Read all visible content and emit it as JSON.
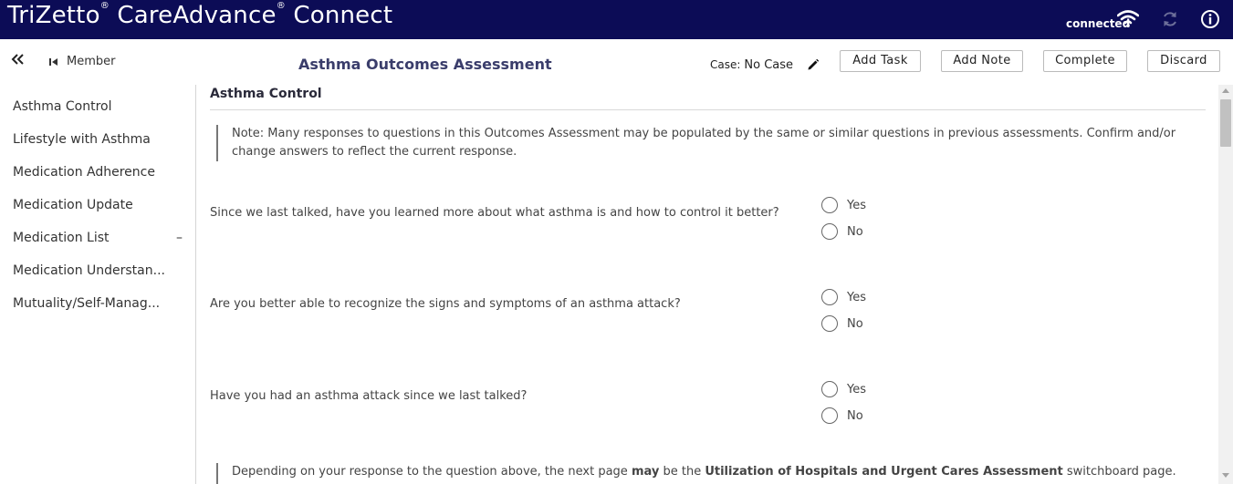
{
  "app": {
    "title": "TriZetto® CareAdvance® Connect",
    "title_parts": [
      "TriZetto",
      "®",
      " CareAdvance",
      "®",
      " Connect"
    ],
    "connection_status": "connected",
    "icons": {
      "connection": "wifi-icon",
      "sync": "sync-icon",
      "info": "info-icon"
    }
  },
  "header": {
    "collapse_icon": "double-chevron-left-icon",
    "member_label": "Member",
    "page_title": "Asthma Outcomes Assessment",
    "case_label": "Case:",
    "case_value": "No Case",
    "buttons": {
      "add_task": "Add Task",
      "add_note": "Add Note",
      "complete": "Complete",
      "discard": "Discard"
    }
  },
  "sidebar": {
    "items": [
      {
        "label": "Asthma Control"
      },
      {
        "label": "Lifestyle with Asthma"
      },
      {
        "label": "Medication Adherence"
      },
      {
        "label": "Medication Update"
      },
      {
        "label": "Medication List",
        "suffix": "–"
      },
      {
        "label": "Medication Understan..."
      },
      {
        "label": "Mutuality/Self-Manag..."
      }
    ]
  },
  "main": {
    "section_title": "Asthma Control",
    "note": "Note: Many responses to questions in this Outcomes Assessment may be populated by the same or similar questions in previous assessments. Confirm and/or change answers to reflect the current response.",
    "questions": [
      {
        "text": "Since we last talked, have you learned more about what asthma is and how to control it better?",
        "options": [
          "Yes",
          "No"
        ]
      },
      {
        "text": "Are you better able to recognize the signs and symptoms of an asthma attack?",
        "options": [
          "Yes",
          "No"
        ]
      },
      {
        "text": "Have you had an asthma attack since we last talked?",
        "options": [
          "Yes",
          "No"
        ]
      }
    ],
    "bottom_note": {
      "part1": "Depending on your response to the question above, the next page ",
      "bold1": "may",
      "part2": " be the ",
      "bold2": "Utilization of Hospitals and Urgent Cares Assessment",
      "part3": " switchboard page. This"
    }
  },
  "colors": {
    "topbar": "#0c0c56",
    "title": "#3a3d6b"
  }
}
